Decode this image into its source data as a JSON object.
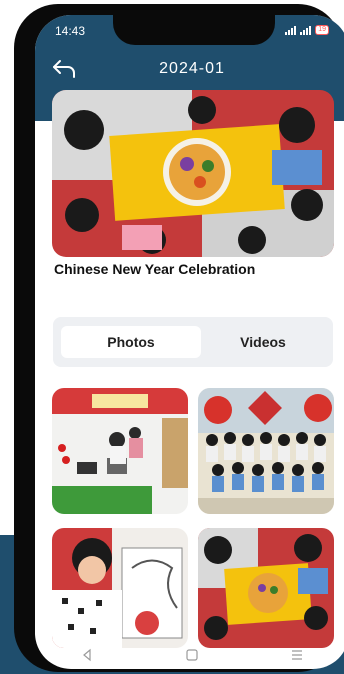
{
  "status_bar": {
    "time": "14:43",
    "battery": "19"
  },
  "header": {
    "title": "2024-01",
    "back_icon": "back-arrow-icon",
    "color": "#1f4e6d"
  },
  "event": {
    "title": "Chinese New Year Celebration"
  },
  "tabs": [
    {
      "label": "Photos",
      "active": true
    },
    {
      "label": "Videos",
      "active": false
    }
  ],
  "gallery": {
    "photo_count_visible": 4
  },
  "nav_bar": {
    "icons": [
      "back-triangle-icon",
      "home-square-icon",
      "menu-lines-icon"
    ]
  }
}
